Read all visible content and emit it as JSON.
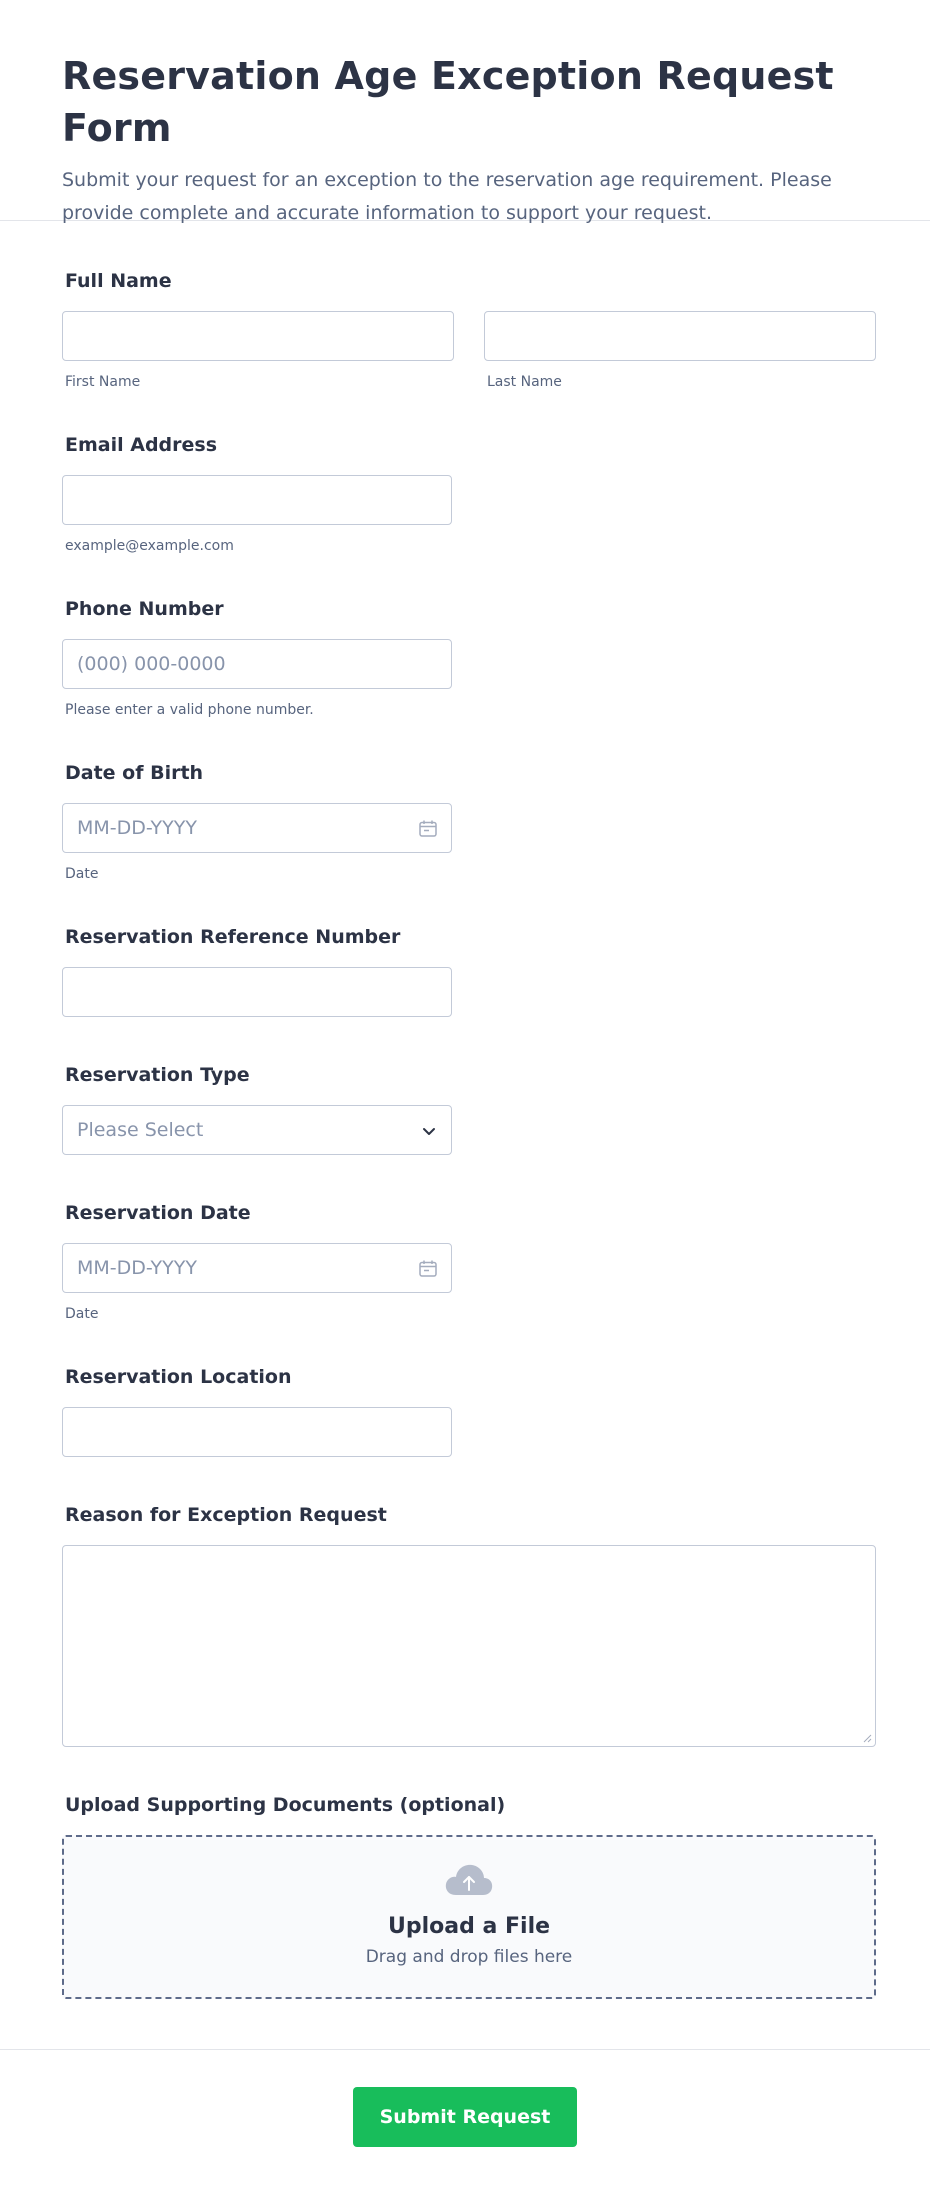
{
  "form": {
    "title": "Reservation Age Exception Request Form",
    "description": "Submit your request for an exception to the reservation age requirement. Please provide complete and accurate information to support your request."
  },
  "fields": {
    "full_name": {
      "label": "Full Name",
      "first_sub": "First Name",
      "last_sub": "Last Name",
      "first_value": "",
      "last_value": ""
    },
    "email": {
      "label": "Email Address",
      "value": "",
      "sub": "example@example.com"
    },
    "phone": {
      "label": "Phone Number",
      "placeholder": "(000) 000-0000",
      "sub": "Please enter a valid phone number."
    },
    "dob": {
      "label": "Date of Birth",
      "placeholder": "MM-DD-YYYY",
      "sub": "Date"
    },
    "ref_number": {
      "label": "Reservation Reference Number",
      "value": ""
    },
    "res_type": {
      "label": "Reservation Type",
      "selected": "Please Select"
    },
    "res_date": {
      "label": "Reservation Date",
      "placeholder": "MM-DD-YYYY",
      "sub": "Date"
    },
    "res_location": {
      "label": "Reservation Location",
      "value": ""
    },
    "reason": {
      "label": "Reason for Exception Request",
      "value": ""
    },
    "upload": {
      "label": "Upload Supporting Documents (optional)",
      "title": "Upload a File",
      "hint": "Drag and drop files here",
      "icon": "cloud-upload-icon"
    }
  },
  "submit": {
    "label": "Submit Request",
    "color": "#18bd5b"
  },
  "colors": {
    "text": "#2c3345",
    "muted": "#57647e",
    "border": "#c3cad8",
    "placeholder": "#8894ab"
  }
}
